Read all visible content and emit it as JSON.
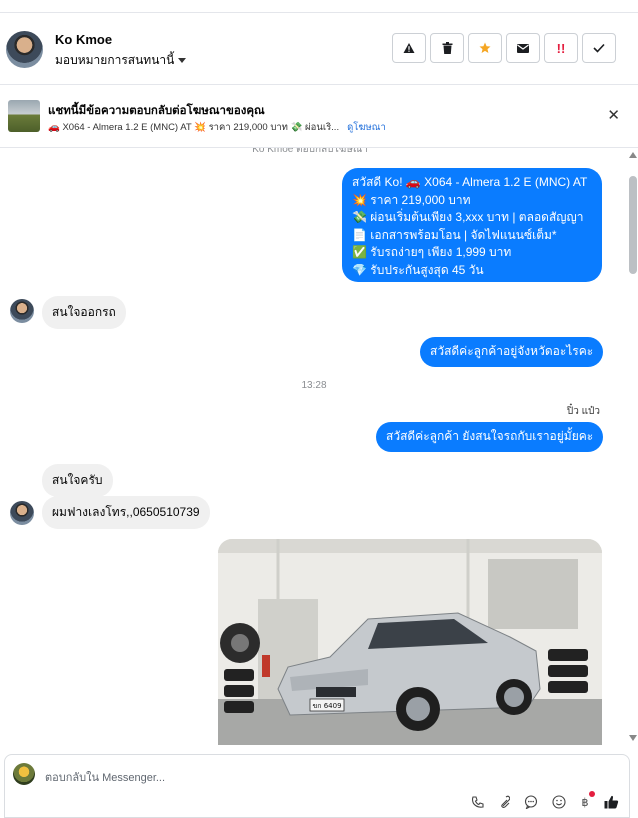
{
  "header": {
    "name": "Ko Kmoe",
    "assign_label": "มอบหมายการสนทนานี้",
    "actions": [
      "warning-icon",
      "trash-icon",
      "star-icon",
      "mail-icon",
      "spam-icon",
      "check-icon"
    ]
  },
  "ad": {
    "title": "แชทนี้มีข้อความตอบกลับต่อโฆษณาของคุณ",
    "subtitle": "🚗 X064 - Almera 1.2 E (MNC) AT 💥 ราคา 219,000 บาท 💸 ผ่อนเริ...",
    "link": "ดูโฆษณา"
  },
  "messages": {
    "system_note": "Ko Kmoe ตอบกลับโฆษณา",
    "outgoing_ad_lines": [
      "สวัสดี Ko! 🚗 X064 - Almera 1.2 E (MNC) AT",
      "💥 ราคา 219,000 บาท",
      "💸 ผ่อนเริ่มต้นเพียง 3,xxx บาท | ตลอดสัญญา",
      "📄 เอกสารพร้อมโอน | จัดไฟแนนซ์เต็ม*",
      "✅ รับรถง่ายๆ เพียง 1,999 บาท",
      "💎 รับประกันสูงสุด 45 วัน"
    ],
    "in_1": "สนใจออกรถ",
    "out_1": "สวัสดีค่ะลูกค้าอยู่จังหวัดอะไรคะ",
    "time": "13:28",
    "sender_name": "ปิ๋ว แป๋ว",
    "out_2": "สวัสดีค่ะลูกค้า ยังสนใจรถกับเราอยู่มั้ยคะ",
    "in_2": "สนใจครับ",
    "in_3": "ผมฟางเลงโทร,,0650510739",
    "plate": "ขก 6409"
  },
  "composer": {
    "placeholder": "ตอบกลับใน Messenger..."
  },
  "colors": {
    "accent": "#0a7cff",
    "link": "#216fdb",
    "incoming_bubble": "#f0f0f0"
  }
}
